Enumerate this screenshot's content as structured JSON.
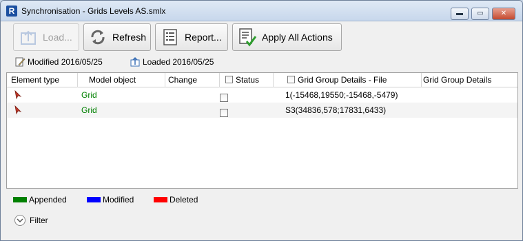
{
  "window": {
    "title": "Synchronisation - Grids Levels AS.smlx",
    "app_icon": "R",
    "controls": {
      "minimize": "▬",
      "maximize": "▭",
      "close": "✕"
    }
  },
  "toolbar": {
    "load_label": "Load...",
    "refresh_label": "Refresh",
    "report_label": "Report...",
    "apply_label": "Apply All Actions"
  },
  "status": {
    "modified": "Modified 2016/05/25",
    "loaded": "Loaded 2016/05/25"
  },
  "table": {
    "columns": [
      {
        "label": "Element type"
      },
      {
        "label": "Model object"
      },
      {
        "label": "Change"
      },
      {
        "label": "Status"
      },
      {
        "label": "Grid Group Details - File"
      },
      {
        "label": "Grid Group Details"
      }
    ],
    "rows": [
      {
        "element_type_icon": "red-flag-icon",
        "model_object": "Grid",
        "change": "",
        "details_file": "1(-15468,19550;-15468,-5479)",
        "details": ""
      },
      {
        "element_type_icon": "red-flag-icon",
        "model_object": "Grid",
        "change": "",
        "details_file": "S3(34836,578;17831,6433)",
        "details": ""
      }
    ]
  },
  "legend": [
    {
      "label": "Appended",
      "color": "#008000"
    },
    {
      "label": "Modified",
      "color": "#0000ff"
    },
    {
      "label": "Deleted",
      "color": "#ff0000"
    }
  ],
  "filter": {
    "label": "Filter"
  }
}
